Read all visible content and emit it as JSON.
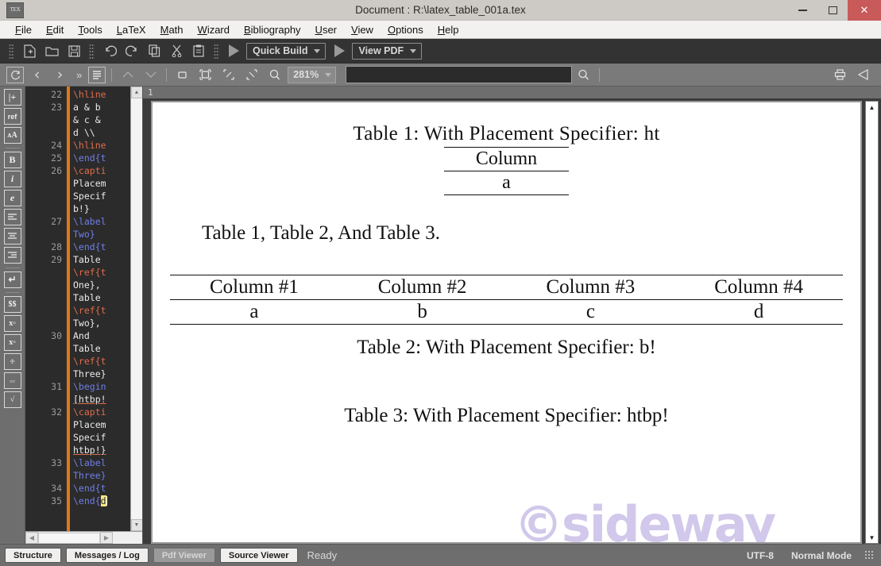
{
  "window": {
    "title": "Document : R:\\latex_table_001a.tex",
    "app_icon": "texmaker-icon",
    "minimize_label": "–",
    "maximize_label": "□",
    "close_label": "✕"
  },
  "menubar": {
    "items": [
      {
        "label": "File",
        "mnemonic": "F"
      },
      {
        "label": "Edit",
        "mnemonic": "E"
      },
      {
        "label": "Tools",
        "mnemonic": "T"
      },
      {
        "label": "LaTeX",
        "mnemonic": "L"
      },
      {
        "label": "Math",
        "mnemonic": "M"
      },
      {
        "label": "Wizard",
        "mnemonic": "W"
      },
      {
        "label": "Bibliography",
        "mnemonic": "B"
      },
      {
        "label": "User",
        "mnemonic": "U"
      },
      {
        "label": "View",
        "mnemonic": "V"
      },
      {
        "label": "Options",
        "mnemonic": "O"
      },
      {
        "label": "Help",
        "mnemonic": "H"
      }
    ]
  },
  "toolbar_main": {
    "icons": [
      "new-document-icon",
      "open-folder-icon",
      "save-icon",
      "undo-icon",
      "redo-icon",
      "copy-icon",
      "cut-icon",
      "paste-icon"
    ],
    "quick_build": {
      "label": "Quick Build",
      "run_icon": "play-icon"
    },
    "view_pdf": {
      "label": "View PDF",
      "run_icon": "play-icon"
    }
  },
  "toolbar_pdf": {
    "refresh_icon": "refresh-icon",
    "prev_icon": "chevron-left-icon",
    "next_icon": "chevron-right-icon",
    "more_label": "»",
    "layout_icon": "page-layout-icon",
    "up_icon": "chevron-up-icon",
    "down_icon": "chevron-down-icon",
    "fit_width_icon": "fit-width-icon",
    "fit_page_icon": "fit-page-icon",
    "zoom_in_icon": "zoom-in-icon",
    "zoom_out_icon": "zoom-out-icon",
    "magnify_icon": "magnifier-icon",
    "zoom_level": "281%",
    "search_placeholder": "",
    "search_value": "",
    "search_icon": "search-icon",
    "print_icon": "print-icon",
    "external_icon": "external-viewer-icon"
  },
  "vertical_toolbar": {
    "items": [
      {
        "icon": "insert-label-icon",
        "label": "|+"
      },
      {
        "icon": "reference-icon",
        "label": "ref"
      },
      {
        "icon": "font-size-icon",
        "label": "A"
      },
      {
        "icon": "bold-icon",
        "label": "B"
      },
      {
        "icon": "italic-icon",
        "label": "i"
      },
      {
        "icon": "emphasis-icon",
        "label": "e"
      },
      {
        "icon": "align-left-icon",
        "label": "≡"
      },
      {
        "icon": "align-center-icon",
        "label": "≡"
      },
      {
        "icon": "align-right-icon",
        "label": "≡"
      },
      {
        "icon": "newline-icon",
        "label": "↵"
      },
      {
        "icon": "math-display-icon",
        "label": "$$"
      },
      {
        "icon": "subscript-icon",
        "label": "x"
      },
      {
        "icon": "superscript-icon",
        "label": "x"
      },
      {
        "icon": "fraction-icon",
        "label": "÷"
      },
      {
        "icon": "binomial-icon",
        "label": "⬚"
      },
      {
        "icon": "sqrt-icon",
        "label": "√"
      }
    ]
  },
  "editor": {
    "lines": [
      {
        "num": "22",
        "tokens": [
          {
            "t": "\\hline",
            "c": "red"
          }
        ]
      },
      {
        "num": "23",
        "tokens": [
          {
            "t": "a & b",
            "c": "white"
          }
        ]
      },
      {
        "num": "",
        "tokens": [
          {
            "t": "& c &",
            "c": "white"
          }
        ]
      },
      {
        "num": "",
        "tokens": [
          {
            "t": "d \\\\",
            "c": "white"
          }
        ]
      },
      {
        "num": "24",
        "tokens": [
          {
            "t": "\\hline",
            "c": "red"
          }
        ]
      },
      {
        "num": "25",
        "tokens": [
          {
            "t": "\\end{t",
            "c": "blue"
          }
        ]
      },
      {
        "num": "26",
        "tokens": [
          {
            "t": "\\capti",
            "c": "red"
          }
        ]
      },
      {
        "num": "",
        "tokens": [
          {
            "t": "Placem",
            "c": "white"
          }
        ]
      },
      {
        "num": "",
        "tokens": [
          {
            "t": "Specif",
            "c": "white"
          }
        ]
      },
      {
        "num": "",
        "tokens": [
          {
            "t": "b!}",
            "c": "white"
          }
        ]
      },
      {
        "num": "27",
        "tokens": [
          {
            "t": "\\label",
            "c": "blue"
          }
        ]
      },
      {
        "num": "",
        "tokens": [
          {
            "t": "Two}",
            "c": "blue"
          }
        ]
      },
      {
        "num": "28",
        "tokens": [
          {
            "t": "\\end{t",
            "c": "blue"
          }
        ]
      },
      {
        "num": "29",
        "tokens": [
          {
            "t": "Table",
            "c": "white"
          }
        ]
      },
      {
        "num": "",
        "tokens": [
          {
            "t": "\\ref{t",
            "c": "red"
          }
        ]
      },
      {
        "num": "",
        "tokens": [
          {
            "t": "One},",
            "c": "white"
          }
        ]
      },
      {
        "num": "",
        "tokens": [
          {
            "t": "Table",
            "c": "white"
          }
        ]
      },
      {
        "num": "",
        "tokens": [
          {
            "t": "\\ref{t",
            "c": "red"
          }
        ]
      },
      {
        "num": "",
        "tokens": [
          {
            "t": "Two},",
            "c": "white"
          }
        ]
      },
      {
        "num": "30",
        "tokens": [
          {
            "t": "And",
            "c": "white"
          }
        ]
      },
      {
        "num": "",
        "tokens": [
          {
            "t": "Table",
            "c": "white"
          }
        ]
      },
      {
        "num": "",
        "tokens": [
          {
            "t": "\\ref{t",
            "c": "red"
          }
        ]
      },
      {
        "num": "",
        "tokens": [
          {
            "t": "Three}",
            "c": "white"
          }
        ]
      },
      {
        "num": "31",
        "tokens": [
          {
            "t": "\\begin",
            "c": "blue"
          }
        ]
      },
      {
        "num": "",
        "tokens": [
          {
            "t": "[htbp!",
            "c": "ul"
          }
        ]
      },
      {
        "num": "32",
        "tokens": [
          {
            "t": "\\capti",
            "c": "red"
          }
        ]
      },
      {
        "num": "",
        "tokens": [
          {
            "t": "Placem",
            "c": "white"
          }
        ]
      },
      {
        "num": "",
        "tokens": [
          {
            "t": "Specif",
            "c": "white"
          }
        ]
      },
      {
        "num": "",
        "tokens": [
          {
            "t": "htbp!}",
            "c": "ul"
          }
        ]
      },
      {
        "num": "33",
        "tokens": [
          {
            "t": "\\label",
            "c": "blue"
          }
        ]
      },
      {
        "num": "",
        "tokens": [
          {
            "t": "Three}",
            "c": "blue"
          }
        ]
      },
      {
        "num": "34",
        "tokens": [
          {
            "t": "\\end{t",
            "c": "blue"
          }
        ]
      },
      {
        "num": "35",
        "tokens": [
          {
            "t": "\\end{",
            "c": "blue"
          },
          {
            "t": "d",
            "c": "hl"
          }
        ]
      }
    ]
  },
  "pdf": {
    "page_label": "1",
    "watermark": "©sideway",
    "caption1": "Table 1: With Placement Specifier: ht",
    "table1": {
      "header": "Column",
      "cell": "a"
    },
    "paragraph": "Table 1, Table 2, And Table 3.",
    "table2": {
      "headers": [
        "Column #1",
        "Column #2",
        "Column #3",
        "Column #4"
      ],
      "row": [
        "a",
        "b",
        "c",
        "d"
      ]
    },
    "caption2": "Table 2: With Placement Specifier: b!",
    "caption3": "Table 3: With Placement Specifier: htbp!"
  },
  "statusbar": {
    "buttons": [
      {
        "label": "Structure",
        "active": false
      },
      {
        "label": "Messages / Log",
        "active": false
      },
      {
        "label": "Pdf Viewer",
        "active": true
      },
      {
        "label": "Source Viewer",
        "active": false
      }
    ],
    "status": "Ready",
    "encoding": "UTF-8",
    "mode": "Normal Mode"
  },
  "colors": {
    "accent_orange": "#e07818",
    "close_red": "#c85a5a",
    "watermark_purple": "#c9bfe8",
    "keyword_red": "#e06c4a",
    "keyword_blue": "#6f7fe8"
  }
}
